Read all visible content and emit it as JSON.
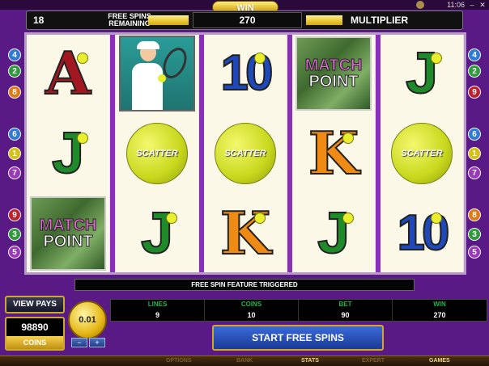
{
  "system": {
    "time": "11:06",
    "minimize_icon": "minimize-icon",
    "close_icon": "close-icon"
  },
  "header": {
    "free_spins_count": "18",
    "free_spins_label_line1": "FREE SPINS",
    "free_spins_label_line2": "REMAINING",
    "win_tab": "WIN",
    "win_value": "270",
    "multiplier_label": "MULTIPLIER"
  },
  "reels": [
    [
      {
        "type": "letter",
        "text": "A"
      },
      {
        "type": "letter",
        "text": "J"
      },
      {
        "type": "matchpoint",
        "line1": "MATCH",
        "line2": "POINT"
      }
    ],
    [
      {
        "type": "player"
      },
      {
        "type": "scatter",
        "text": "SCATTER"
      },
      {
        "type": "letter",
        "text": "J"
      }
    ],
    [
      {
        "type": "letter",
        "text": "10"
      },
      {
        "type": "scatter",
        "text": "SCATTER"
      },
      {
        "type": "letter",
        "text": "K"
      }
    ],
    [
      {
        "type": "matchpoint",
        "line1": "MATCH",
        "line2": "POINT"
      },
      {
        "type": "letter",
        "text": "K"
      },
      {
        "type": "letter",
        "text": "J"
      }
    ],
    [
      {
        "type": "letter",
        "text": "J"
      },
      {
        "type": "scatter",
        "text": "SCATTER"
      },
      {
        "type": "letter",
        "text": "10"
      }
    ]
  ],
  "paylines_left": [
    {
      "n": "4",
      "color": "#2e7bd6"
    },
    {
      "n": "2",
      "color": "#2e9a3a"
    },
    {
      "n": "8",
      "color": "#e07a12"
    },
    {
      "n": "6",
      "color": "#2e7bd6"
    },
    {
      "n": "1",
      "color": "#d8c010"
    },
    {
      "n": "7",
      "color": "#9b3ab8"
    },
    {
      "n": "9",
      "color": "#c0202a"
    },
    {
      "n": "3",
      "color": "#2e9a3a"
    },
    {
      "n": "5",
      "color": "#9b3ab8"
    }
  ],
  "paylines_right": [
    {
      "n": "4",
      "color": "#2e7bd6"
    },
    {
      "n": "2",
      "color": "#2e9a3a"
    },
    {
      "n": "9",
      "color": "#c0202a"
    },
    {
      "n": "6",
      "color": "#2e7bd6"
    },
    {
      "n": "1",
      "color": "#d8c010"
    },
    {
      "n": "7",
      "color": "#9b3ab8"
    },
    {
      "n": "8",
      "color": "#e07a12"
    },
    {
      "n": "3",
      "color": "#2e9a3a"
    },
    {
      "n": "5",
      "color": "#9b3ab8"
    }
  ],
  "message": "FREE SPIN FEATURE TRIGGERED",
  "controls": {
    "view_pays": "VIEW PAYS",
    "balance": "98890",
    "balance_label": "COINS",
    "coin_size": "0.01",
    "coin_minus": "−",
    "coin_plus": "+",
    "stats": [
      {
        "label": "LINES",
        "value": "9"
      },
      {
        "label": "COINS",
        "value": "10"
      },
      {
        "label": "BET",
        "value": "90"
      },
      {
        "label": "WIN",
        "value": "270"
      }
    ],
    "start": "START FREE SPINS"
  },
  "menu": [
    {
      "label": "OPTIONS",
      "active": false
    },
    {
      "label": "BANK",
      "active": false
    },
    {
      "label": "STATS",
      "active": true
    },
    {
      "label": "EXPERT",
      "active": false
    },
    {
      "label": "GAMES",
      "active": true
    }
  ],
  "colors": {
    "background": "#5a1a86",
    "reel_separator": "#8c2fb8",
    "gold": "#d1a72a",
    "stat_label": "#22b14c"
  }
}
